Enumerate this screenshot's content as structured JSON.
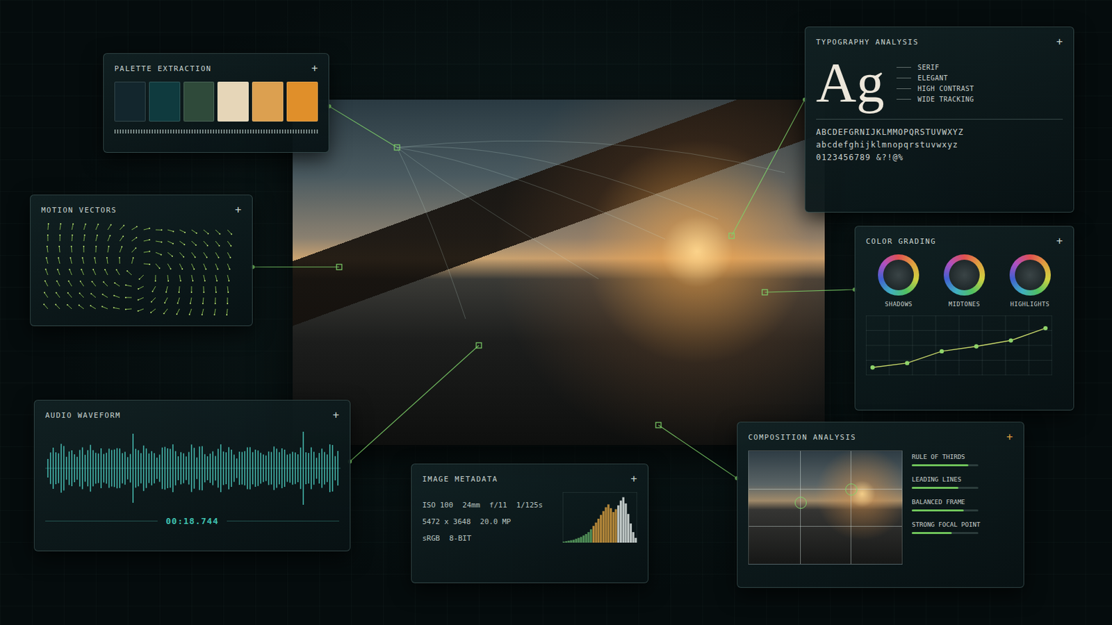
{
  "palette": {
    "title": "PALETTE EXTRACTION",
    "add": "+",
    "swatches": [
      {
        "color": "#13262d"
      },
      {
        "color": "#0f3a3e"
      },
      {
        "color": "#2f4a3a"
      },
      {
        "color": "#e6d6b8"
      },
      {
        "color": "#dca050"
      },
      {
        "color": "#e08f2a"
      }
    ]
  },
  "motion_vectors": {
    "title": "MOTION VECTORS",
    "add": "+"
  },
  "audio_waveform": {
    "title": "AUDIO WAVEFORM",
    "add": "+",
    "time": "00:18.744"
  },
  "image_metadata": {
    "title": "IMAGE METADATA",
    "add": "+",
    "rows": [
      [
        "ISO 100",
        "24mm",
        "f/11",
        "1/125s"
      ],
      [
        "5472 x 3648",
        "20.0 MP"
      ],
      [
        "sRGB",
        "8-BIT"
      ]
    ],
    "histogram": {
      "values": [
        2,
        3,
        4,
        5,
        6,
        8,
        10,
        12,
        15,
        18,
        22,
        28,
        35,
        42,
        50,
        58,
        66,
        74,
        80,
        72,
        64,
        70,
        78,
        88,
        95,
        82,
        60,
        40,
        22,
        10
      ]
    }
  },
  "typography": {
    "title": "TYPOGRAPHY ANALYSIS",
    "add": "+",
    "specimen": "Ag",
    "traits": [
      "SERIF",
      "ELEGANT",
      "HIGH CONTRAST",
      "WIDE TRACKING"
    ],
    "glyph_lines": [
      "ABCDEFGRNIJKLMMOPQRSTUVWXYZ",
      "abcdefghijklmnopqrstuvwxyz",
      "0123456789 &?!@%"
    ]
  },
  "color_grading": {
    "title": "COLOR GRADING",
    "add": "+",
    "wheels": [
      {
        "label": "SHADOWS"
      },
      {
        "label": "MIDTONES"
      },
      {
        "label": "HIGHLIGHTS"
      }
    ],
    "curve": {
      "values": [
        0.05,
        0.14,
        0.38,
        0.48,
        0.6,
        0.85
      ]
    }
  },
  "composition": {
    "title": "COMPOSITION ANALYSIS",
    "add": "+",
    "metrics": [
      {
        "label": "RULE OF THIRDS",
        "level": 0.85
      },
      {
        "label": "LEADING LINES",
        "level": 0.7
      },
      {
        "label": "BALANCED FRAME",
        "level": 0.78
      },
      {
        "label": "STRONG FOCAL POINT",
        "level": 0.6
      }
    ]
  }
}
